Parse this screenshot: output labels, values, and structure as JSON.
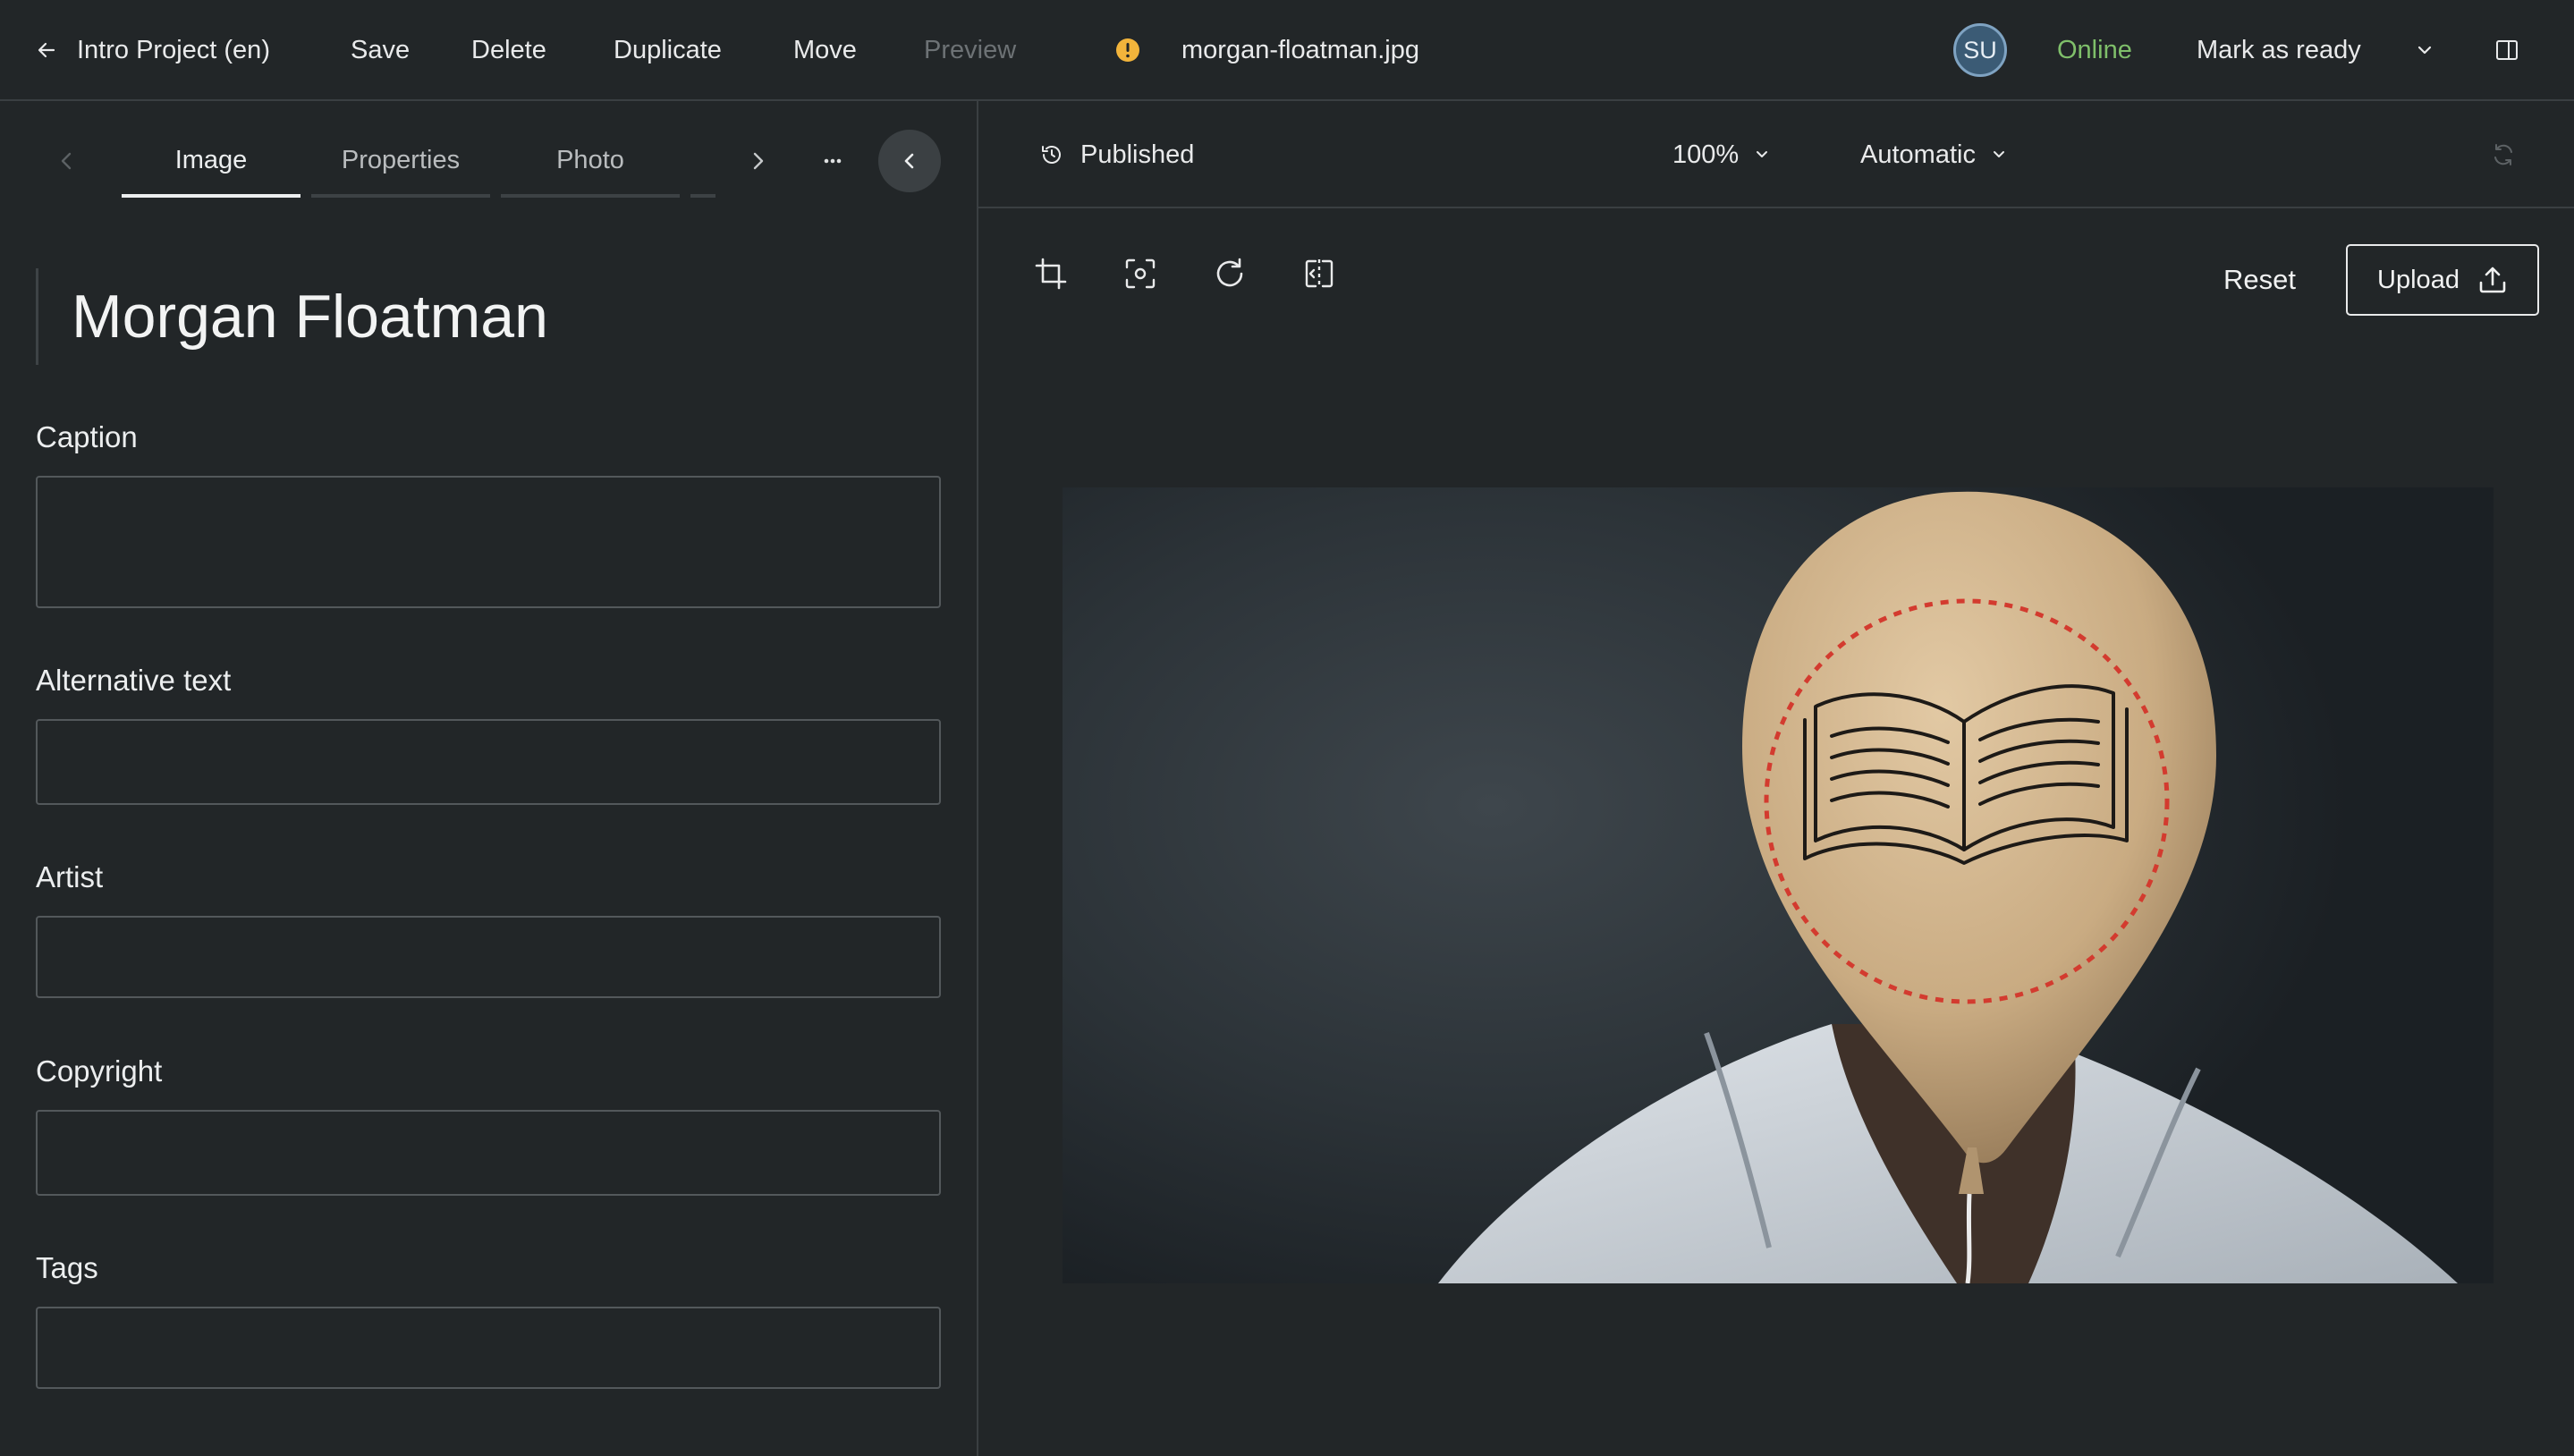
{
  "topbar": {
    "back_label": "Intro Project (en)",
    "save": "Save",
    "delete": "Delete",
    "duplicate": "Duplicate",
    "move": "Move",
    "preview": "Preview",
    "filename": "morgan-floatman.jpg",
    "avatar_initials": "SU",
    "status": "Online",
    "mark_ready": "Mark as ready",
    "colors": {
      "status": "#7fbf6a",
      "warning": "#f2b43b",
      "avatar_bg": "#3b5b75"
    }
  },
  "left": {
    "tabs": [
      {
        "label": "Image",
        "active": true
      },
      {
        "label": "Properties",
        "active": false
      },
      {
        "label": "Photo",
        "active": false
      }
    ],
    "title": "Morgan Floatman",
    "fields": [
      {
        "label": "Caption",
        "value": ""
      },
      {
        "label": "Alternative text",
        "value": ""
      },
      {
        "label": "Artist",
        "value": ""
      },
      {
        "label": "Copyright",
        "value": ""
      },
      {
        "label": "Tags",
        "value": ""
      }
    ]
  },
  "right": {
    "published": "Published",
    "zoom": "100%",
    "mode": "Automatic",
    "reset": "Reset",
    "upload": "Upload",
    "tools": [
      "crop-icon",
      "focus-icon",
      "rotate-icon",
      "flip-icon"
    ],
    "image_alt": "morgan-floatman.jpg"
  }
}
